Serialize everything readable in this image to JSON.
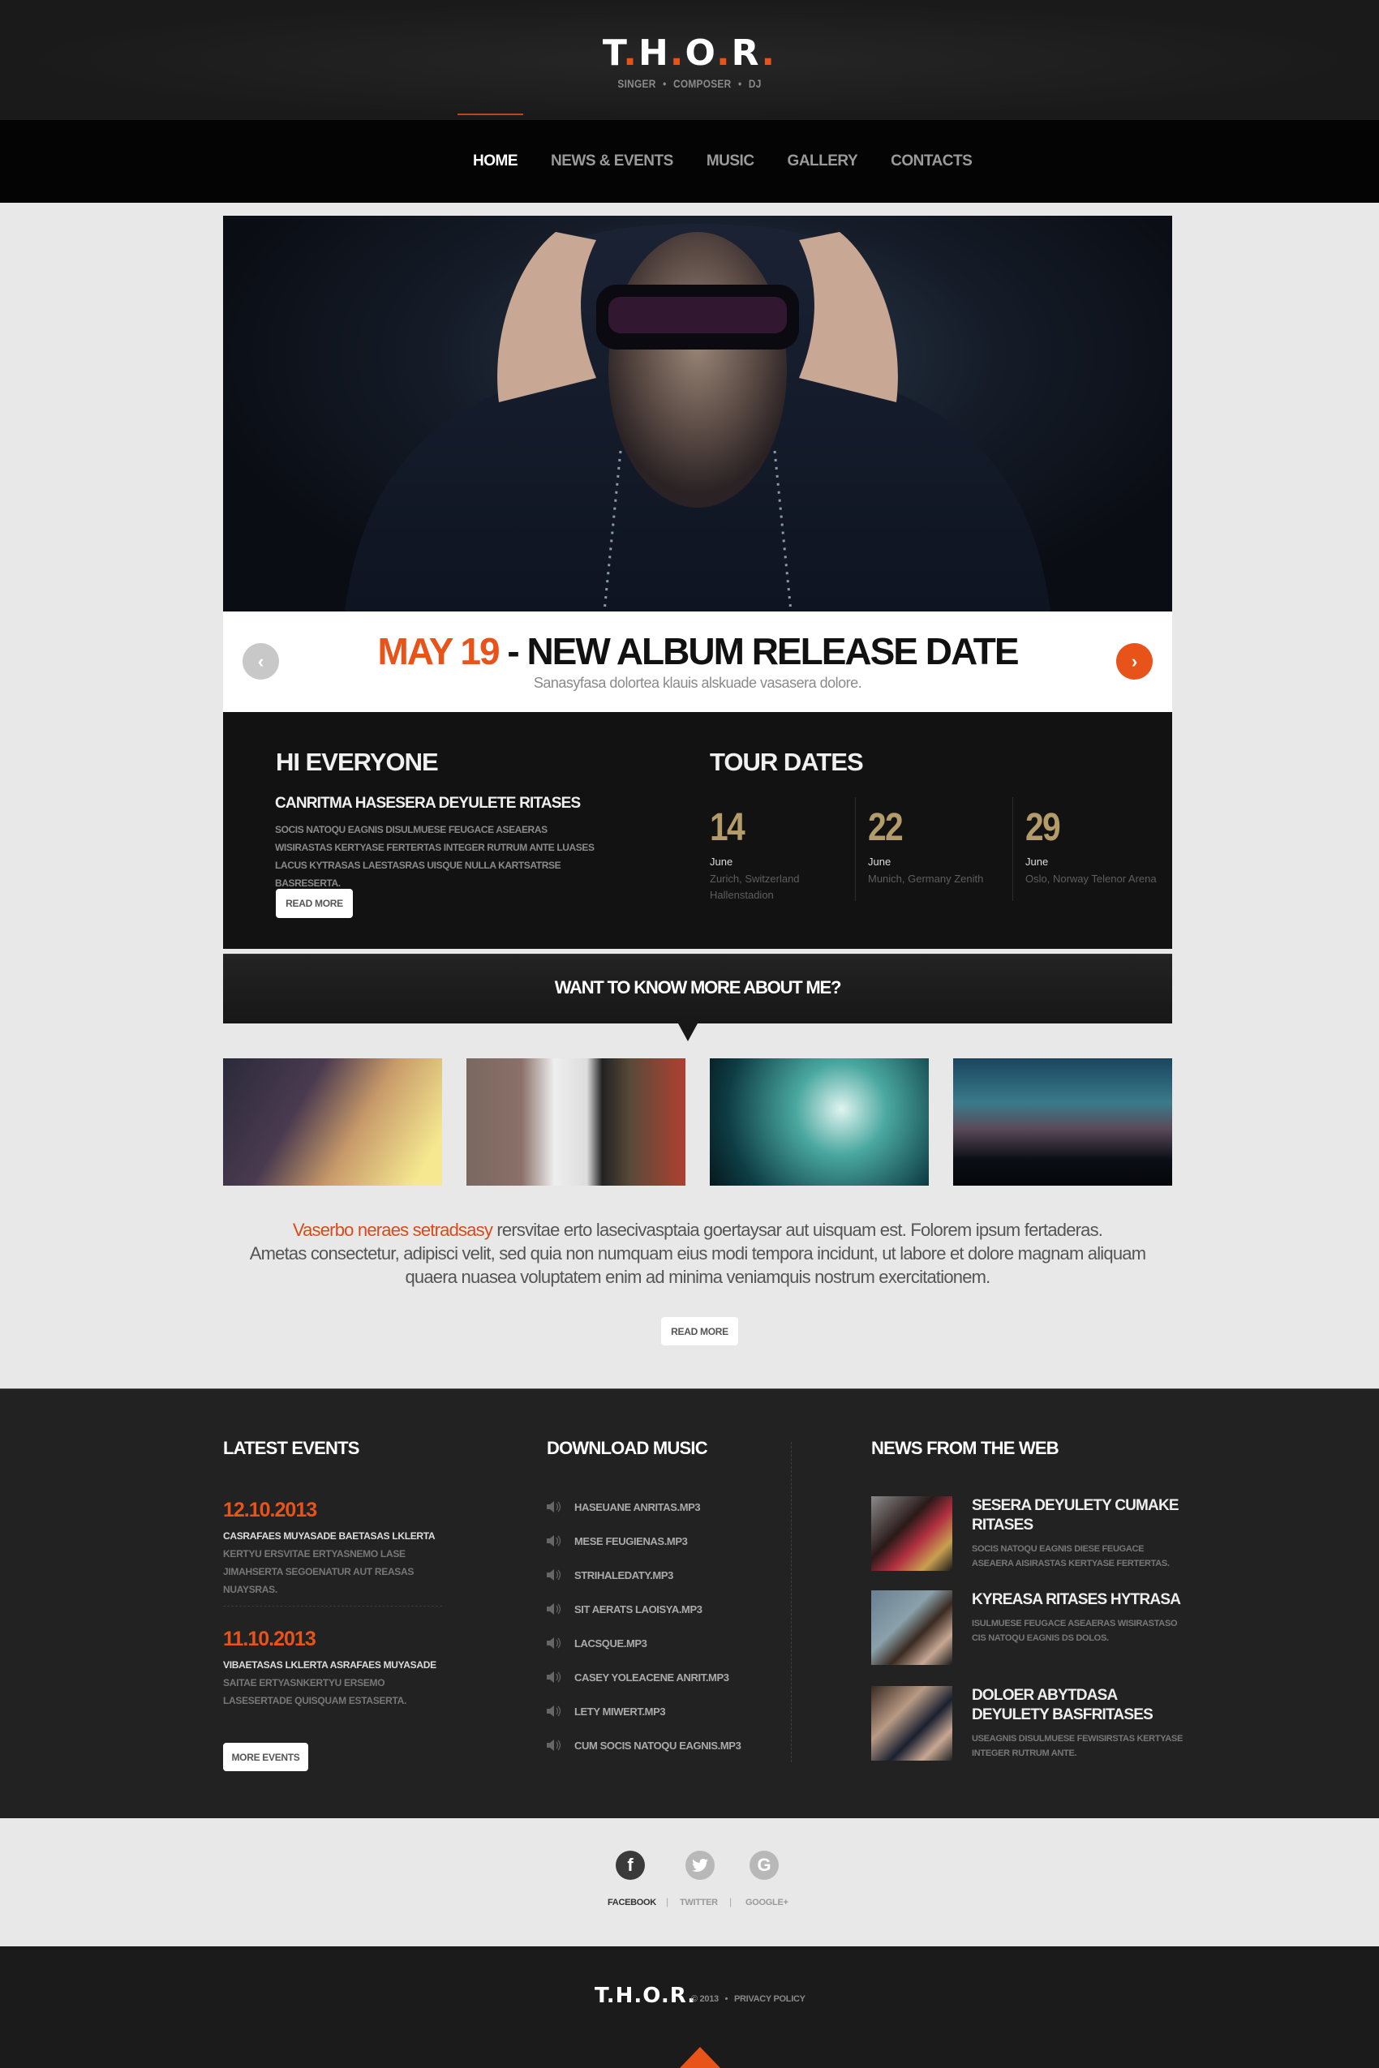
{
  "header": {
    "logo_letters": [
      "T",
      "H",
      "O",
      "R"
    ],
    "logo_dot": ".",
    "tagline": [
      "SINGER",
      "COMPOSER",
      "DJ"
    ],
    "tagline_sep": "•"
  },
  "nav": {
    "items": [
      {
        "label": "HOME",
        "active": true
      },
      {
        "label": "NEWS & EVENTS",
        "active": false
      },
      {
        "label": "MUSIC",
        "active": false
      },
      {
        "label": "GALLERY",
        "active": false
      },
      {
        "label": "CONTACTS",
        "active": false
      }
    ]
  },
  "slider": {
    "highlight": "MAY 19",
    "title": " - NEW ALBUM RELEASE DATE",
    "subtitle": "Sanasyfasa dolortea klauis alskuade vasasera dolore.",
    "prev_icon": "‹",
    "next_icon": "›"
  },
  "intro": {
    "title": "HI EVERYONE",
    "subtitle": "CANRITMA HASESERA DEYULETE RITASES",
    "body": "SOCIS NATOQU EAGNIS DISULMUESE FEUGACE ASEAERAS WISIRASTAS KERTYASE FERTERTAS INTEGER RUTRUM ANTE LUASES LACUS KYTRASAS LAESTASRAS UISQUE NULLA KARTSATRSE BASRESERTA.",
    "button": "READ MORE"
  },
  "tour": {
    "title": "TOUR DATES",
    "dates": [
      {
        "day": "14",
        "month": "June",
        "location": "Zurich, Switzerland Hallenstadion"
      },
      {
        "day": "22",
        "month": "June",
        "location": "Munich, Germany Zenith"
      },
      {
        "day": "29",
        "month": "June",
        "location": "Oslo, Norway Telenor Arena"
      }
    ]
  },
  "about": {
    "banner": "WANT TO KNOW MORE ABOUT ME?",
    "highlight": "Vaserbo neraes setradsasy",
    "line1": " rersvitae erto lasecivasptaia goertaysar aut uisquam est. Folorem ipsum fertaderas.",
    "line2": "Ametas consectetur, adipisci velit, sed quia non numquam eius modi tempora incidunt, ut labore et dolore magnam aliquam quaera nuasea voluptatem enim ad minima veniamquis nostrum exercitationem.",
    "button": "READ MORE",
    "thumbs": [
      "guitar-closeup",
      "guitarist",
      "microphone-stage",
      "concert-crowd"
    ]
  },
  "events": {
    "title": "LATEST EVENTS",
    "items": [
      {
        "date": "12.10.2013",
        "title": "CASRAFAES MUYASADE BAETASAS LKLERTA",
        "body": "KERTYU ERSVITAE ERTYASNEMO LASE JIMAHSERTA SEGOENATUR AUT  REASAS NUAYSRAS."
      },
      {
        "date": "11.10.2013",
        "title": "VIBAETASAS LKLERTA ASRAFAES MUYASADE",
        "body": "SAITAE ERTYASNKERTYU ERSEMO LASESERTADE QUISQUAM ESTASERTA."
      }
    ],
    "button": "MORE EVENTS"
  },
  "music": {
    "title": "DOWNLOAD MUSIC",
    "tracks": [
      "HASEUANE ANRITAS.MP3",
      "MESE FEUGIENAS.MP3",
      "STRIHALEDATY.MP3",
      "SIT AERATS LAOISYA.MP3",
      "LACSQUE.MP3",
      "CASEY YOLEACENE ANRIT.MP3",
      "LETY MIWERT.MP3",
      "CUM SOCIS NATOQU EAGNIS.MP3"
    ]
  },
  "news": {
    "title": "NEWS FROM THE WEB",
    "items": [
      {
        "title": "SESERA DEYULETY CUMAKE RITASES",
        "body": "SOCIS NATOQU EAGNIS DIESE FEUGACE ASEAERA AISIRASTAS KERTYASE FERTERTAS."
      },
      {
        "title": "KYREASA RITASES HYTRASA",
        "body": "ISULMUESE FEUGACE ASEAERAS WISIRASTASO CIS NATOQU EAGNIS DS DOLOS."
      },
      {
        "title": "DOLOER ABYTDASA  DEYULETY BASFRITASES",
        "body": "USEAGNIS DISULMUESE FEWISIRSTAS KERTYASE INTEGER RUTRUM ANTE."
      }
    ]
  },
  "social": {
    "items": [
      {
        "label": "FACEBOOK",
        "glyph": "f",
        "active": true
      },
      {
        "label": "TWITTER",
        "glyph": "t",
        "active": false
      },
      {
        "label": "GOOGLE+",
        "glyph": "G",
        "active": false
      }
    ],
    "separator": "|"
  },
  "footer": {
    "logo": "T.H.O.R.",
    "copyright": "© 2013",
    "sep": "•",
    "privacy": "PRIVACY POLICY"
  },
  "colors": {
    "accent": "#e8531a",
    "gold": "#b39c6a",
    "dark": "#121212",
    "light_bg": "#e8e8e8"
  }
}
